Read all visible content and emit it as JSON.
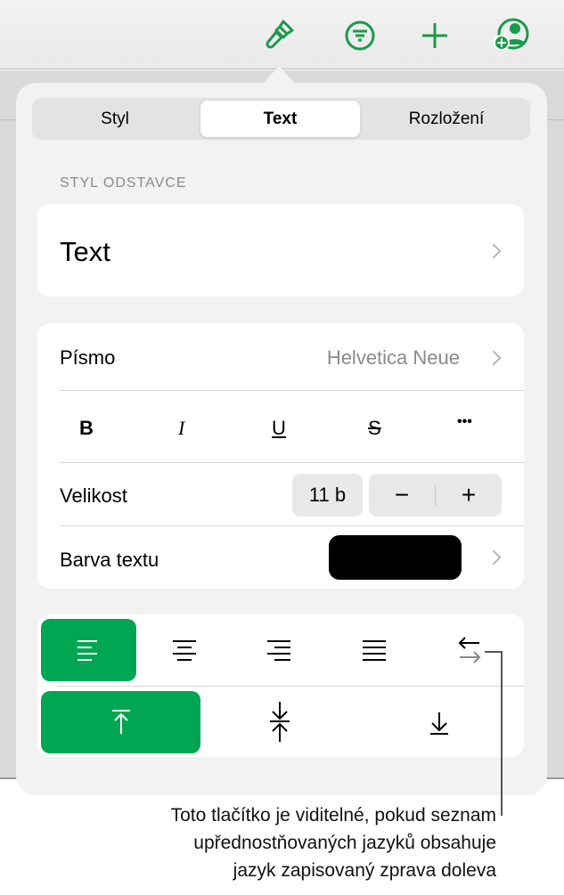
{
  "toolbar": {
    "icons": [
      "paintbrush-icon",
      "filter-icon",
      "plus-icon",
      "add-person-icon"
    ],
    "accent": "#1a9a4a"
  },
  "tabs": [
    {
      "label": "Styl"
    },
    {
      "label": "Text",
      "selected": true
    },
    {
      "label": "Rozložení"
    }
  ],
  "paragraph_style": {
    "section_label": "STYL ODSTAVCE",
    "value": "Text"
  },
  "font": {
    "label": "Písmo",
    "value": "Helvetica Neue",
    "style_buttons": [
      "B",
      "I",
      "U",
      "S",
      "•••"
    ]
  },
  "size": {
    "label": "Velikost",
    "value": "11 b",
    "decrease": "−",
    "increase": "+"
  },
  "text_color": {
    "label": "Barva textu",
    "color": "#000000"
  },
  "alignment": {
    "selected": "left",
    "buttons": [
      "align-left",
      "align-center",
      "align-right",
      "justify",
      "text-direction"
    ]
  },
  "vertical_alignment": {
    "selected": "top",
    "buttons": [
      "top",
      "middle",
      "bottom"
    ]
  },
  "callout": {
    "line1": "Toto tlačítko je viditelné, pokud seznam",
    "line2": "upřednostňovaných jazyků obsahuje",
    "line3": "jazyk zapisovaný zprava doleva"
  },
  "colors": {
    "green": "#00a651"
  }
}
